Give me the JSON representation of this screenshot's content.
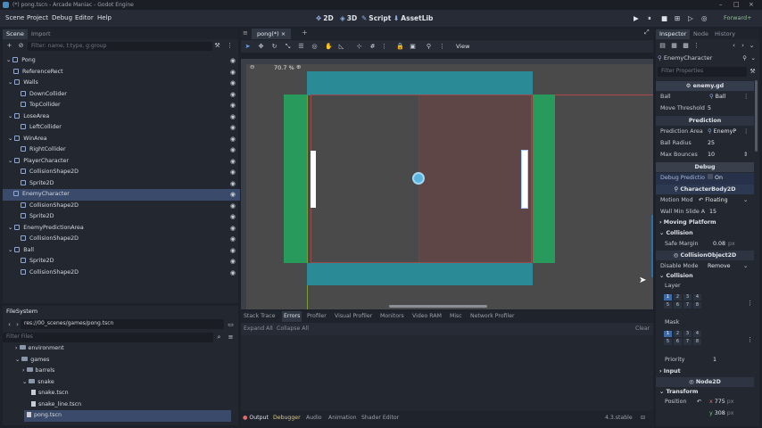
{
  "window": {
    "title": "(*) pong.tscn - Arcade Maniac - Godot Engine"
  },
  "menu": [
    "Scene",
    "Project",
    "Debug",
    "Editor",
    "Help"
  ],
  "workspaces": [
    "2D",
    "3D",
    "Script",
    "AssetLib"
  ],
  "renderer": "Forward+",
  "scene_dock": {
    "tabs": [
      "Scene",
      "Import"
    ],
    "filter_placeholder": "Filter: name, t:type, g:group",
    "nodes": [
      {
        "label": "Pong",
        "depth": 0
      },
      {
        "label": "ReferenceRect",
        "depth": 1
      },
      {
        "label": "Walls",
        "depth": 1
      },
      {
        "label": "DownCollider",
        "depth": 2
      },
      {
        "label": "TopCollider",
        "depth": 2
      },
      {
        "label": "LoseArea",
        "depth": 1
      },
      {
        "label": "LeftCollider",
        "depth": 2
      },
      {
        "label": "WinArea",
        "depth": 1
      },
      {
        "label": "RightCollider",
        "depth": 2
      },
      {
        "label": "PlayerCharacter",
        "depth": 1
      },
      {
        "label": "CollisionShape2D",
        "depth": 2
      },
      {
        "label": "Sprite2D",
        "depth": 2
      },
      {
        "label": "EnemyCharacter",
        "depth": 1,
        "selected": true
      },
      {
        "label": "CollisionShape2D",
        "depth": 2
      },
      {
        "label": "Sprite2D",
        "depth": 2
      },
      {
        "label": "EnemyPredictionArea",
        "depth": 1
      },
      {
        "label": "CollisionShape2D",
        "depth": 2
      },
      {
        "label": "Ball",
        "depth": 1
      },
      {
        "label": "Sprite2D",
        "depth": 2
      },
      {
        "label": "CollisionShape2D",
        "depth": 2
      }
    ]
  },
  "filesystem": {
    "title": "FileSystem",
    "path": "res://00_scenes/games/pong.tscn",
    "filter_placeholder": "Filter Files",
    "items": [
      {
        "label": "environment",
        "type": "folder",
        "depth": 1
      },
      {
        "label": "games",
        "type": "folder",
        "depth": 1
      },
      {
        "label": "barrels",
        "type": "folder",
        "depth": 2
      },
      {
        "label": "snake",
        "type": "folder",
        "depth": 2
      },
      {
        "label": "snake.tscn",
        "type": "file",
        "depth": 3
      },
      {
        "label": "snake_line.tscn",
        "type": "file",
        "depth": 3
      },
      {
        "label": "pong.tscn",
        "type": "file",
        "depth": 2,
        "selected": true
      }
    ]
  },
  "editor": {
    "scene_tab": "pong(*)",
    "toolbar_view": "View",
    "zoom": "70.7 %"
  },
  "bottom": {
    "debugger_tabs": [
      "Stack Trace",
      "Errors",
      "Profiler",
      "Visual Profiler",
      "Monitors",
      "Video RAM",
      "Misc",
      "Network Profiler"
    ],
    "active_tab": "Errors",
    "expand_all": "Expand All",
    "collapse_all": "Collapse All",
    "clear": "Clear",
    "dock_tabs": [
      "Output",
      "Debugger",
      "Audio",
      "Animation",
      "Shader Editor"
    ],
    "version": "4.3.stable"
  },
  "inspector": {
    "tabs": [
      "Inspector",
      "Node",
      "History"
    ],
    "node_name": "EnemyCharacter",
    "filter_placeholder": "Filter Properties",
    "script": "enemy.gd",
    "ball_label": "Ball",
    "ball_value": "Ball",
    "move_threshold_label": "Move Threshold",
    "move_threshold_value": "5",
    "prediction_section": "Prediction",
    "prediction_area_label": "Prediction Area",
    "prediction_area_value": "EnemyP",
    "ball_radius_label": "Ball Radius",
    "ball_radius_value": "25",
    "max_bounces_label": "Max Bounces",
    "max_bounces_value": "10",
    "debug_section": "Debug",
    "debug_prediction_label": "Debug Predictio",
    "debug_prediction_value": "On",
    "characterbody_section": "CharacterBody2D",
    "motion_mode_label": "Motion Mod",
    "motion_mode_value": "Floating",
    "wall_min_slide_label": "Wall Min Slide A",
    "wall_min_slide_value": "15",
    "moving_platform": "Moving Platform",
    "collision_group": "Collision",
    "safe_margin_label": "Safe Margin",
    "safe_margin_value": "0.08",
    "safe_margin_unit": "px",
    "collisionobject_section": "CollisionObject2D",
    "disable_mode_label": "Disable Mode",
    "disable_mode_value": "Remove",
    "collision_sub": "Collision",
    "layer_label": "Layer",
    "mask_label": "Mask",
    "layer_cells": [
      "1",
      "2",
      "3",
      "4",
      "5",
      "6",
      "7",
      "8"
    ],
    "priority_label": "Priority",
    "priority_value": "1",
    "input_group": "Input",
    "node2d_section": "Node2D",
    "transform_group": "Transform",
    "position_label": "Position",
    "pos_x": "775",
    "pos_y": "308",
    "pos_unit": "px"
  }
}
